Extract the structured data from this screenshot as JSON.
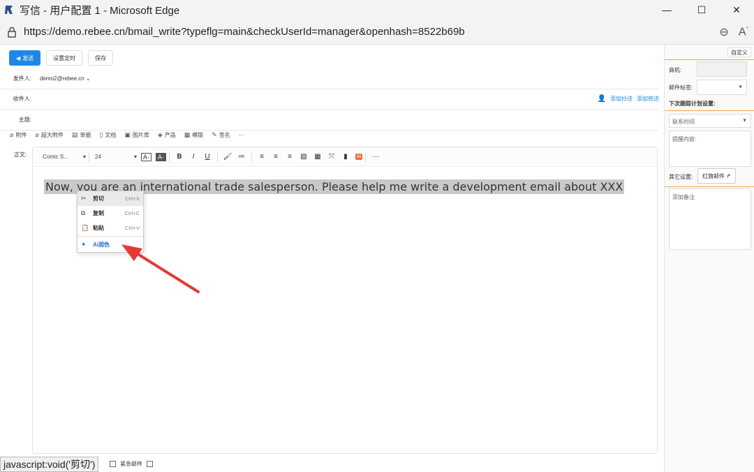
{
  "window": {
    "title": "写信 - 用户配置 1 - Microsoft Edge",
    "url": "https://demo.rebee.cn/bmail_write?typeflg=main&checkUserId=manager&openhash=8522b69b",
    "minimize": "—",
    "maximize": "☐",
    "close": "✕"
  },
  "toolbar": {
    "send_label": "发送",
    "schedule_label": "设置定时",
    "save_label": "保存"
  },
  "fields": {
    "sender_label": "发件人:",
    "sender_value": "demo2@rebee.cn ⌄",
    "recipient_label": "收件人:",
    "add_cc": "添加抄送",
    "add_bcc": "添加密送",
    "subject_label": "主题:"
  },
  "attach_bar": [
    {
      "icon": "paperclip-icon",
      "glyph": "⊘",
      "label": "附件"
    },
    {
      "icon": "big-attachment-icon",
      "glyph": "⊘",
      "label": "超大附件"
    },
    {
      "icon": "document-icon",
      "glyph": "▤",
      "label": "单据"
    },
    {
      "icon": "file-icon",
      "glyph": "▯",
      "label": "文档"
    },
    {
      "icon": "image-icon",
      "glyph": "▣",
      "label": "图片库"
    },
    {
      "icon": "product-icon",
      "glyph": "◈",
      "label": "产品"
    },
    {
      "icon": "template-icon",
      "glyph": "▦",
      "label": "模版"
    },
    {
      "icon": "signature-icon",
      "glyph": "✎",
      "label": "签名"
    },
    {
      "icon": "more-icon",
      "glyph": "",
      "label": "···"
    }
  ],
  "editor": {
    "body_label": "正文:",
    "font_name": "Comic S...",
    "font_size": "24",
    "content": "Now, you are an international trade salesperson. Please help me write a development email about XXX"
  },
  "context_menu": {
    "cut_label": "剪切",
    "cut_shortcut": "Ctrl+X",
    "copy_label": "复制",
    "copy_shortcut": "Ctrl+C",
    "paste_label": "粘贴",
    "paste_shortcut": "Ctrl+V",
    "ai_label": "Ai润色"
  },
  "status_tip": "javascript:void('剪切')",
  "bottom_opts": {
    "urgent_label": "紧急邮件"
  },
  "side": {
    "customize_label": "自定义",
    "opportunity_label": "商机:",
    "mail_tag_label": "邮件标签:",
    "next_follow_label": "下次跟踪计划设置:",
    "contact_time": "联系时间",
    "reminder_label": "提醒内容:",
    "other_settings_label": "其它设置:",
    "red_flag_label": "红旗邮件 ↱",
    "remark_placeholder": "添加备注"
  },
  "colors": {
    "accent": "#1e88e5",
    "divider": "#f0a640",
    "arrow": "#e53935",
    "ai_badge": "#ef6c3a"
  }
}
